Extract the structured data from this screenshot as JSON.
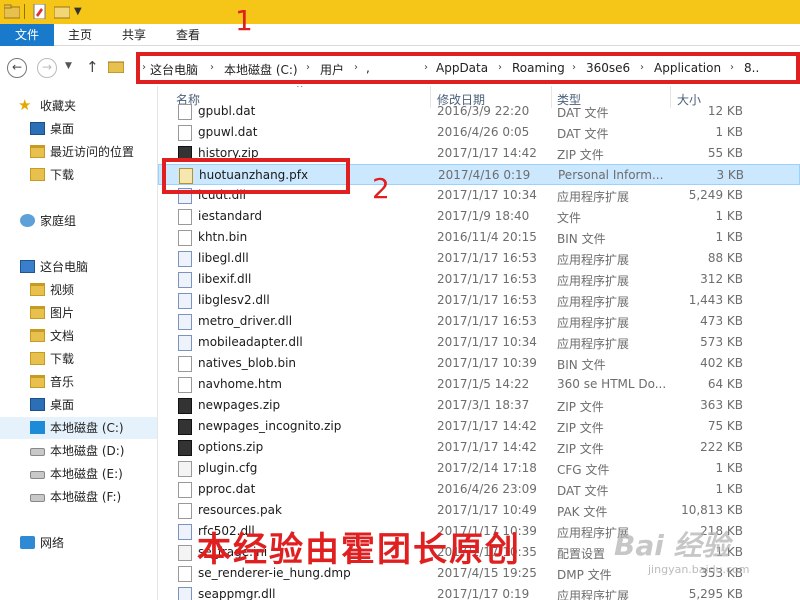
{
  "ribbon": {
    "file": "文件",
    "home": "主页",
    "share": "共享",
    "view": "查看"
  },
  "breadcrumb": [
    {
      "label": "这台电脑"
    },
    {
      "label": "本地磁盘 (C:)"
    },
    {
      "label": "用户"
    },
    {
      "label": ","
    },
    {
      "label": "AppData"
    },
    {
      "label": "Roaming"
    },
    {
      "label": "360se6"
    },
    {
      "label": "Application"
    },
    {
      "label": "8.."
    }
  ],
  "annotations": {
    "one": "1",
    "two": "2",
    "watermark": "本经验由霍团长原创",
    "baidu": "Bai 经验",
    "baidu_sub": "jingyan.baidu.com"
  },
  "sidebar": {
    "items": [
      {
        "label": "收藏夹",
        "icon": "star-icon"
      },
      {
        "label": "桌面",
        "icon": "desktop-icon"
      },
      {
        "label": "最近访问的位置",
        "icon": "recent-places-icon"
      },
      {
        "label": "下载",
        "icon": "downloads-icon"
      },
      {
        "label": "家庭组",
        "icon": "homegroup-icon"
      },
      {
        "label": "这台电脑",
        "icon": "computer-icon"
      },
      {
        "label": "视频",
        "icon": "folder-icon"
      },
      {
        "label": "图片",
        "icon": "folder-icon"
      },
      {
        "label": "文档",
        "icon": "folder-icon"
      },
      {
        "label": "下载",
        "icon": "downloads-icon"
      },
      {
        "label": "音乐",
        "icon": "folder-icon"
      },
      {
        "label": "桌面",
        "icon": "desktop-icon"
      },
      {
        "label": "本地磁盘 (C:)",
        "icon": "windows-drive-icon"
      },
      {
        "label": "本地磁盘 (D:)",
        "icon": "drive-icon"
      },
      {
        "label": "本地磁盘 (E:)",
        "icon": "drive-icon"
      },
      {
        "label": "本地磁盘 (F:)",
        "icon": "drive-icon"
      },
      {
        "label": "网络",
        "icon": "network-icon"
      }
    ]
  },
  "columns": {
    "name": "名称",
    "date": "修改日期",
    "type": "类型",
    "size": "大小"
  },
  "files": [
    {
      "name": "gpubl.dat",
      "date": "2016/3/9 22:20",
      "type": "DAT 文件",
      "size": "12 KB"
    },
    {
      "name": "gpuwl.dat",
      "date": "2016/4/26 0:05",
      "type": "DAT 文件",
      "size": "1 KB"
    },
    {
      "name": "history.zip",
      "date": "2017/1/17 14:42",
      "type": "ZIP 文件",
      "size": "55 KB"
    },
    {
      "name": "huotuanzhang.pfx",
      "date": "2017/4/16 0:19",
      "type": "Personal Inform...",
      "size": "3 KB"
    },
    {
      "name": "icudt.dll",
      "date": "2017/1/17 10:34",
      "type": "应用程序扩展",
      "size": "5,249 KB"
    },
    {
      "name": "iestandard",
      "date": "2017/1/9 18:40",
      "type": "文件",
      "size": "1 KB"
    },
    {
      "name": "khtn.bin",
      "date": "2016/11/4 20:15",
      "type": "BIN 文件",
      "size": "1 KB"
    },
    {
      "name": "libegl.dll",
      "date": "2017/1/17 16:53",
      "type": "应用程序扩展",
      "size": "88 KB"
    },
    {
      "name": "libexif.dll",
      "date": "2017/1/17 16:53",
      "type": "应用程序扩展",
      "size": "312 KB"
    },
    {
      "name": "libglesv2.dll",
      "date": "2017/1/17 16:53",
      "type": "应用程序扩展",
      "size": "1,443 KB"
    },
    {
      "name": "metro_driver.dll",
      "date": "2017/1/17 16:53",
      "type": "应用程序扩展",
      "size": "473 KB"
    },
    {
      "name": "mobileadapter.dll",
      "date": "2017/1/17 10:34",
      "type": "应用程序扩展",
      "size": "573 KB"
    },
    {
      "name": "natives_blob.bin",
      "date": "2017/1/17 10:39",
      "type": "BIN 文件",
      "size": "402 KB"
    },
    {
      "name": "navhome.htm",
      "date": "2017/1/5 14:22",
      "type": "360 se HTML Do...",
      "size": "64 KB"
    },
    {
      "name": "newpages.zip",
      "date": "2017/3/1 18:37",
      "type": "ZIP 文件",
      "size": "363 KB"
    },
    {
      "name": "newpages_incognito.zip",
      "date": "2017/1/17 14:42",
      "type": "ZIP 文件",
      "size": "75 KB"
    },
    {
      "name": "options.zip",
      "date": "2017/1/17 14:42",
      "type": "ZIP 文件",
      "size": "222 KB"
    },
    {
      "name": "plugin.cfg",
      "date": "2017/2/14 17:18",
      "type": "CFG 文件",
      "size": "1 KB"
    },
    {
      "name": "pproc.dat",
      "date": "2016/4/26 23:09",
      "type": "DAT 文件",
      "size": "1 KB"
    },
    {
      "name": "resources.pak",
      "date": "2017/1/17 10:49",
      "type": "PAK 文件",
      "size": "10,813 KB"
    },
    {
      "name": "rfc502.dll",
      "date": "2017/1/17 10:39",
      "type": "应用程序扩展",
      "size": "218 KB"
    },
    {
      "name": "se_frage.ini",
      "date": "2017/1/17 10:35",
      "type": "配置设置",
      "size": "1 KB"
    },
    {
      "name": "se_renderer-ie_hung.dmp",
      "date": "2017/4/15 19:25",
      "type": "DMP 文件",
      "size": "353 KB"
    },
    {
      "name": "seappmgr.dll",
      "date": "2017/1/17 0:19",
      "type": "应用程序扩展",
      "size": "5,295 KB"
    }
  ]
}
